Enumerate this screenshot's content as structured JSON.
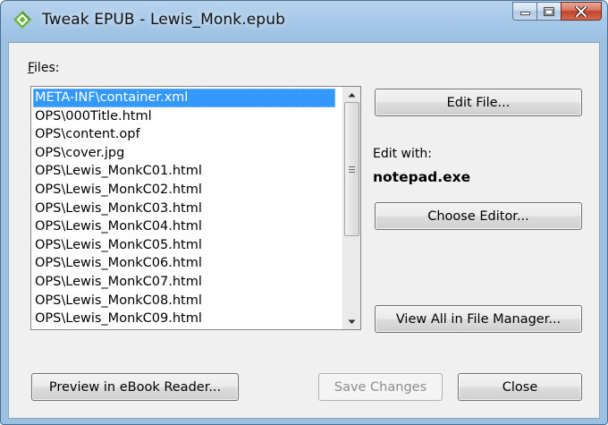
{
  "window": {
    "title": "Tweak EPUB - Lewis_Monk.epub",
    "icons": {
      "app": "epub-app-icon",
      "minimize": "minimize-icon",
      "maximize": "maximize-icon",
      "close": "close-icon"
    }
  },
  "files": {
    "label_accel": "F",
    "label_rest": "iles:",
    "items": [
      "META-INF\\container.xml",
      "OPS\\000Title.html",
      "OPS\\content.opf",
      "OPS\\cover.jpg",
      "OPS\\Lewis_MonkC01.html",
      "OPS\\Lewis_MonkC02.html",
      "OPS\\Lewis_MonkC03.html",
      "OPS\\Lewis_MonkC04.html",
      "OPS\\Lewis_MonkC05.html",
      "OPS\\Lewis_MonkC06.html",
      "OPS\\Lewis_MonkC07.html",
      "OPS\\Lewis_MonkC08.html",
      "OPS\\Lewis_MonkC09.html"
    ],
    "selected_index": 0
  },
  "editor": {
    "edit_file_label": "Edit File...",
    "edit_with_label": "Edit with:",
    "editor_name": "notepad.exe",
    "choose_editor_label": "Choose Editor...",
    "view_all_label": "View All in File Manager..."
  },
  "footer": {
    "preview_label": "Preview in eBook Reader...",
    "save_label": "Save Changes",
    "close_label": "Close"
  },
  "colors": {
    "selection": "#3399ff",
    "titlebar": "#a7c8e8",
    "close_button": "#c2432a"
  }
}
